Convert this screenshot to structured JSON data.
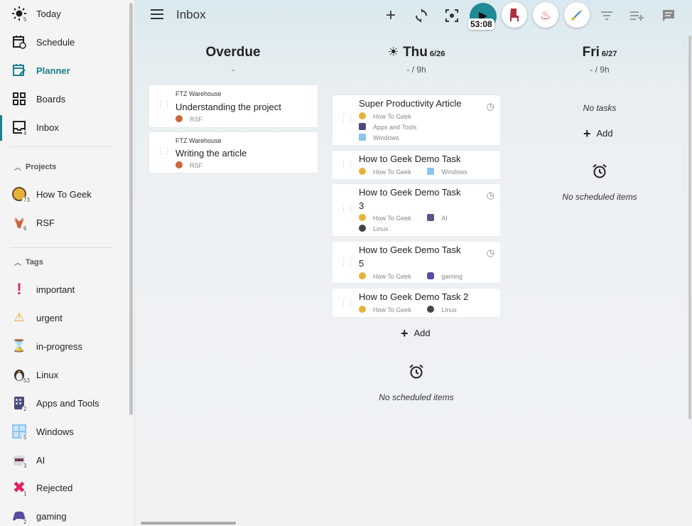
{
  "sidebar": {
    "main_items": [
      {
        "label": "Today",
        "icon": "sun-icon",
        "count": "5"
      },
      {
        "label": "Schedule",
        "icon": "calendar-clock-icon",
        "count": ""
      },
      {
        "label": "Planner",
        "icon": "calendar-edit-icon",
        "count": ""
      },
      {
        "label": "Boards",
        "icon": "grid-icon",
        "count": ""
      },
      {
        "label": "Inbox",
        "icon": "inbox-icon",
        "count": "4"
      }
    ],
    "projects_heading": "Projects",
    "projects": [
      {
        "label": "How To Geek",
        "count": "73",
        "color": "#e8b23a"
      },
      {
        "label": "RSF",
        "count": "6",
        "color": "#c7673a"
      }
    ],
    "tags_heading": "Tags",
    "tags": [
      {
        "label": "important",
        "count": "",
        "icon": "!",
        "color": "#e0245e"
      },
      {
        "label": "urgent",
        "count": "",
        "icon": "⚠",
        "color": "#e8a020"
      },
      {
        "label": "in-progress",
        "count": "",
        "icon": "⌛",
        "color": "#b89a6a"
      },
      {
        "label": "Linux",
        "count": "53",
        "icon": "penguin",
        "color": "#444444"
      },
      {
        "label": "Apps and Tools",
        "count": "2",
        "icon": "tools",
        "color": "#4a4a7a"
      },
      {
        "label": "Windows",
        "count": "5",
        "icon": "windows",
        "color": "#6aa8e0"
      },
      {
        "label": "AI",
        "count": "3",
        "icon": "robot",
        "color": "#555588"
      },
      {
        "label": "Rejected",
        "count": "1",
        "icon": "✖",
        "color": "#e0245e"
      },
      {
        "label": "gaming",
        "count": "2",
        "icon": "gamepad",
        "color": "#5a4aa0"
      }
    ]
  },
  "header": {
    "title": "Inbox",
    "timer": "53:08"
  },
  "columns": {
    "overdue": {
      "title": "Overdue",
      "sub": "-",
      "cards": [
        {
          "project": "FTZ Warehouse",
          "title": "Understanding the project",
          "tag": "RSF"
        },
        {
          "project": "FTZ Warehouse",
          "title": "Writing the article",
          "tag": "RSF"
        }
      ]
    },
    "thu": {
      "title": "Thu",
      "date": "6/26",
      "sub": "- / 9h",
      "cards": [
        {
          "title": "Super Productivity Article",
          "tags": [
            "How To Geek",
            "Apps and Tools",
            "Windows"
          ]
        },
        {
          "title": "How to Geek Demo Task",
          "tags": [
            "How To Geek",
            "Windows"
          ]
        },
        {
          "title_line1": "How to Geek Demo Task",
          "title_line2": "3",
          "tags": [
            "How To Geek",
            "AI",
            "Linux"
          ]
        },
        {
          "title_line1": "How to Geek Demo Task",
          "title_line2": "5",
          "tags": [
            "How To Geek",
            "gaming"
          ]
        },
        {
          "title": "How to Geek Demo Task 2",
          "tags": [
            "How To Geek",
            "Linux"
          ]
        }
      ],
      "add_label": "Add",
      "no_scheduled": "No scheduled items"
    },
    "fri": {
      "title": "Fri",
      "date": "6/27",
      "sub": "- / 9h",
      "no_tasks": "No tasks",
      "add_label": "Add",
      "no_scheduled": "No scheduled items"
    }
  },
  "colors": {
    "accent": "#1d7f8c",
    "play": "#1f8a96"
  }
}
